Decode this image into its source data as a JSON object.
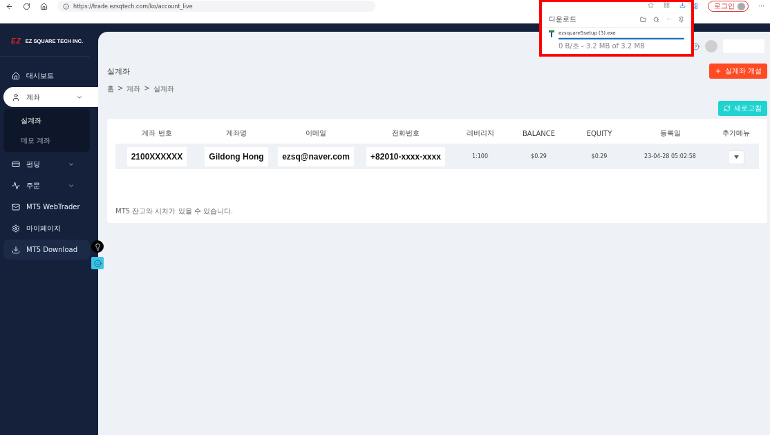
{
  "browser": {
    "url": "https://trade.ezsqtech.com/ko/account_live",
    "login_button": "로그인",
    "menu": "···"
  },
  "download_panel": {
    "title": "다운로드",
    "file": "ezsquare5setup (3).exe",
    "progress": {
      "level": 1
    },
    "status": "0 B/초 - 3.2 MB of 3.2 MB",
    "more": "···"
  },
  "sidebar": {
    "logo": "EZ",
    "company": "EZ SQUARE TECH INC.",
    "items": [
      {
        "label": "대시보드",
        "selected": false,
        "highlighted": false
      },
      {
        "label": "계좌",
        "selected": true,
        "highlighted": false,
        "expanded": true,
        "children": [
          {
            "label": "실계좌",
            "selected": true
          },
          {
            "label": "데모 계좌",
            "selected": false
          }
        ]
      },
      {
        "label": "펀딩",
        "selected": false,
        "highlighted": false,
        "expanded": false
      },
      {
        "label": "주문",
        "selected": false,
        "highlighted": false,
        "expanded": false
      },
      {
        "label": "MT5 WebTrader",
        "selected": false,
        "highlighted": false
      },
      {
        "label": "마이페이지",
        "selected": false,
        "highlighted": false
      },
      {
        "label": "MT5 Download",
        "selected": false,
        "highlighted": true
      }
    ]
  },
  "page": {
    "title": "실계좌",
    "breadcrumb": [
      "홈",
      "계좌",
      "실계좌"
    ],
    "separator": ">",
    "open_button": "실계좌 개설",
    "refresh_button": "새로고침"
  },
  "table": {
    "columns": [
      "계좌 번호",
      "계좌명",
      "이메일",
      "전화번호",
      "레버리지",
      "BALANCE",
      "EQUITY",
      "등록일",
      "추가메뉴"
    ],
    "rows": [
      {
        "account": "2100XXXXXX",
        "name": "Gildong Hong",
        "email": "ezsq@naver.com",
        "phone": "+82010-xxxx-xxxx",
        "leverage": "1:100",
        "balance": "$0.29",
        "equity": "$0.29",
        "registered": "23-04-28 05:02:58"
      }
    ]
  },
  "note": "MT5 잔고와 시차가 있을 수 있습니다."
}
